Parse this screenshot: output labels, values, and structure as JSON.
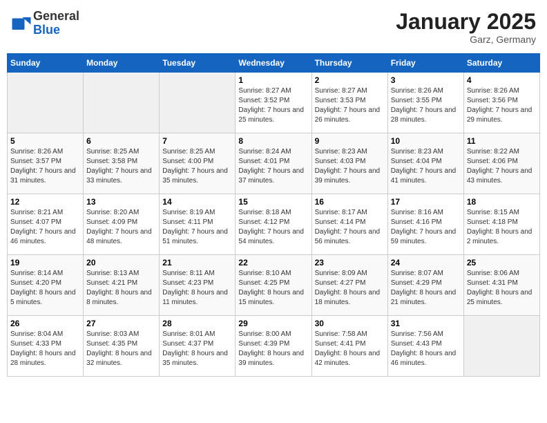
{
  "logo": {
    "general": "General",
    "blue": "Blue"
  },
  "title": {
    "month_year": "January 2025",
    "location": "Garz, Germany"
  },
  "weekdays": [
    "Sunday",
    "Monday",
    "Tuesday",
    "Wednesday",
    "Thursday",
    "Friday",
    "Saturday"
  ],
  "weeks": [
    [
      {
        "day": "",
        "sunrise": "",
        "sunset": "",
        "daylight": "",
        "empty": true
      },
      {
        "day": "",
        "sunrise": "",
        "sunset": "",
        "daylight": "",
        "empty": true
      },
      {
        "day": "",
        "sunrise": "",
        "sunset": "",
        "daylight": "",
        "empty": true
      },
      {
        "day": "1",
        "sunrise": "Sunrise: 8:27 AM",
        "sunset": "Sunset: 3:52 PM",
        "daylight": "Daylight: 7 hours and 25 minutes."
      },
      {
        "day": "2",
        "sunrise": "Sunrise: 8:27 AM",
        "sunset": "Sunset: 3:53 PM",
        "daylight": "Daylight: 7 hours and 26 minutes."
      },
      {
        "day": "3",
        "sunrise": "Sunrise: 8:26 AM",
        "sunset": "Sunset: 3:55 PM",
        "daylight": "Daylight: 7 hours and 28 minutes."
      },
      {
        "day": "4",
        "sunrise": "Sunrise: 8:26 AM",
        "sunset": "Sunset: 3:56 PM",
        "daylight": "Daylight: 7 hours and 29 minutes."
      }
    ],
    [
      {
        "day": "5",
        "sunrise": "Sunrise: 8:26 AM",
        "sunset": "Sunset: 3:57 PM",
        "daylight": "Daylight: 7 hours and 31 minutes."
      },
      {
        "day": "6",
        "sunrise": "Sunrise: 8:25 AM",
        "sunset": "Sunset: 3:58 PM",
        "daylight": "Daylight: 7 hours and 33 minutes."
      },
      {
        "day": "7",
        "sunrise": "Sunrise: 8:25 AM",
        "sunset": "Sunset: 4:00 PM",
        "daylight": "Daylight: 7 hours and 35 minutes."
      },
      {
        "day": "8",
        "sunrise": "Sunrise: 8:24 AM",
        "sunset": "Sunset: 4:01 PM",
        "daylight": "Daylight: 7 hours and 37 minutes."
      },
      {
        "day": "9",
        "sunrise": "Sunrise: 8:23 AM",
        "sunset": "Sunset: 4:03 PM",
        "daylight": "Daylight: 7 hours and 39 minutes."
      },
      {
        "day": "10",
        "sunrise": "Sunrise: 8:23 AM",
        "sunset": "Sunset: 4:04 PM",
        "daylight": "Daylight: 7 hours and 41 minutes."
      },
      {
        "day": "11",
        "sunrise": "Sunrise: 8:22 AM",
        "sunset": "Sunset: 4:06 PM",
        "daylight": "Daylight: 7 hours and 43 minutes."
      }
    ],
    [
      {
        "day": "12",
        "sunrise": "Sunrise: 8:21 AM",
        "sunset": "Sunset: 4:07 PM",
        "daylight": "Daylight: 7 hours and 46 minutes."
      },
      {
        "day": "13",
        "sunrise": "Sunrise: 8:20 AM",
        "sunset": "Sunset: 4:09 PM",
        "daylight": "Daylight: 7 hours and 48 minutes."
      },
      {
        "day": "14",
        "sunrise": "Sunrise: 8:19 AM",
        "sunset": "Sunset: 4:11 PM",
        "daylight": "Daylight: 7 hours and 51 minutes."
      },
      {
        "day": "15",
        "sunrise": "Sunrise: 8:18 AM",
        "sunset": "Sunset: 4:12 PM",
        "daylight": "Daylight: 7 hours and 54 minutes."
      },
      {
        "day": "16",
        "sunrise": "Sunrise: 8:17 AM",
        "sunset": "Sunset: 4:14 PM",
        "daylight": "Daylight: 7 hours and 56 minutes."
      },
      {
        "day": "17",
        "sunrise": "Sunrise: 8:16 AM",
        "sunset": "Sunset: 4:16 PM",
        "daylight": "Daylight: 7 hours and 59 minutes."
      },
      {
        "day": "18",
        "sunrise": "Sunrise: 8:15 AM",
        "sunset": "Sunset: 4:18 PM",
        "daylight": "Daylight: 8 hours and 2 minutes."
      }
    ],
    [
      {
        "day": "19",
        "sunrise": "Sunrise: 8:14 AM",
        "sunset": "Sunset: 4:20 PM",
        "daylight": "Daylight: 8 hours and 5 minutes."
      },
      {
        "day": "20",
        "sunrise": "Sunrise: 8:13 AM",
        "sunset": "Sunset: 4:21 PM",
        "daylight": "Daylight: 8 hours and 8 minutes."
      },
      {
        "day": "21",
        "sunrise": "Sunrise: 8:11 AM",
        "sunset": "Sunset: 4:23 PM",
        "daylight": "Daylight: 8 hours and 11 minutes."
      },
      {
        "day": "22",
        "sunrise": "Sunrise: 8:10 AM",
        "sunset": "Sunset: 4:25 PM",
        "daylight": "Daylight: 8 hours and 15 minutes."
      },
      {
        "day": "23",
        "sunrise": "Sunrise: 8:09 AM",
        "sunset": "Sunset: 4:27 PM",
        "daylight": "Daylight: 8 hours and 18 minutes."
      },
      {
        "day": "24",
        "sunrise": "Sunrise: 8:07 AM",
        "sunset": "Sunset: 4:29 PM",
        "daylight": "Daylight: 8 hours and 21 minutes."
      },
      {
        "day": "25",
        "sunrise": "Sunrise: 8:06 AM",
        "sunset": "Sunset: 4:31 PM",
        "daylight": "Daylight: 8 hours and 25 minutes."
      }
    ],
    [
      {
        "day": "26",
        "sunrise": "Sunrise: 8:04 AM",
        "sunset": "Sunset: 4:33 PM",
        "daylight": "Daylight: 8 hours and 28 minutes."
      },
      {
        "day": "27",
        "sunrise": "Sunrise: 8:03 AM",
        "sunset": "Sunset: 4:35 PM",
        "daylight": "Daylight: 8 hours and 32 minutes."
      },
      {
        "day": "28",
        "sunrise": "Sunrise: 8:01 AM",
        "sunset": "Sunset: 4:37 PM",
        "daylight": "Daylight: 8 hours and 35 minutes."
      },
      {
        "day": "29",
        "sunrise": "Sunrise: 8:00 AM",
        "sunset": "Sunset: 4:39 PM",
        "daylight": "Daylight: 8 hours and 39 minutes."
      },
      {
        "day": "30",
        "sunrise": "Sunrise: 7:58 AM",
        "sunset": "Sunset: 4:41 PM",
        "daylight": "Daylight: 8 hours and 42 minutes."
      },
      {
        "day": "31",
        "sunrise": "Sunrise: 7:56 AM",
        "sunset": "Sunset: 4:43 PM",
        "daylight": "Daylight: 8 hours and 46 minutes."
      },
      {
        "day": "",
        "sunrise": "",
        "sunset": "",
        "daylight": "",
        "empty": true
      }
    ]
  ]
}
